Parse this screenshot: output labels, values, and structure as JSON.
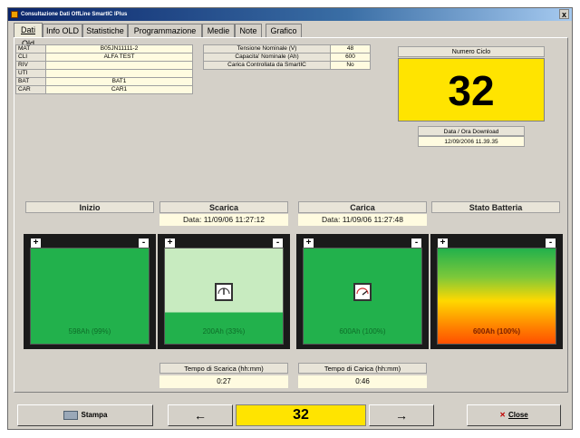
{
  "window": {
    "title": "Consultazione Dati OffLine SmartIC IPlus",
    "close_glyph": "x"
  },
  "tabs": [
    {
      "label": "Dati Old"
    },
    {
      "label": "Info OLD"
    },
    {
      "label": "Statistiche"
    },
    {
      "label": "Programmazione"
    },
    {
      "label": "Medie"
    },
    {
      "label": "Note"
    },
    {
      "label": "Grafico"
    }
  ],
  "ident_table": [
    {
      "label": "MAT",
      "value": "B05JN11111-2"
    },
    {
      "label": "CLI",
      "value": "ALFA TEST"
    },
    {
      "label": "RIV",
      "value": ""
    },
    {
      "label": "UTI",
      "value": ""
    },
    {
      "label": "BAT",
      "value": "BAT1"
    },
    {
      "label": "CAR",
      "value": "CAR1"
    }
  ],
  "params_table": [
    {
      "label": "Tensione Nominale (V)",
      "value": "48"
    },
    {
      "label": "Capacita' Nominale (Ah)",
      "value": "600"
    },
    {
      "label": "Carica Controllata da SmartIC",
      "value": "No"
    }
  ],
  "cycle": {
    "label": "Numero Ciclo",
    "value": "32"
  },
  "download": {
    "label": "Data / Ora Download",
    "value": "12/09/2006 11.39.35"
  },
  "columns": [
    {
      "title": "Inizio",
      "date": ""
    },
    {
      "title": "Scarica",
      "date": "Data: 11/09/06 11:27:12"
    },
    {
      "title": "Carica",
      "date": "Data: 11/09/06 11:27:48"
    },
    {
      "title": "Stato Batteria",
      "date": ""
    }
  ],
  "batteries": [
    {
      "label": "598Ah (99%)",
      "fill_fraction": 0.99,
      "color": "#22b14c",
      "icon": "none"
    },
    {
      "label": "200Ah (33%)",
      "fill_fraction": 0.33,
      "color": "#22b14c",
      "icon": "discharge-gauge-icon"
    },
    {
      "label": "600Ah (100%)",
      "fill_fraction": 1.0,
      "color": "#22b14c",
      "icon": "charge-gauge-icon"
    },
    {
      "label": "600Ah (100%)",
      "fill_fraction": 1.0,
      "color": "gradient",
      "icon": "none"
    }
  ],
  "terminals": {
    "positive": "+",
    "negative": "-"
  },
  "durations": [
    {
      "label": "Tempo di Scarica (hh:mm)",
      "value": "0:27"
    },
    {
      "label": "Tempo di Carica (hh:mm)",
      "value": "0:46"
    }
  ],
  "footer": {
    "print_label": "Stampa",
    "prev_glyph": "←",
    "cycle_value": "32",
    "next_glyph": "→",
    "close_label": "Close",
    "close_glyph": "✕"
  },
  "colors": {
    "accent_yellow": "#ffe400",
    "battery_green": "#22b14c",
    "discharged_light": "#c8ebc0"
  }
}
